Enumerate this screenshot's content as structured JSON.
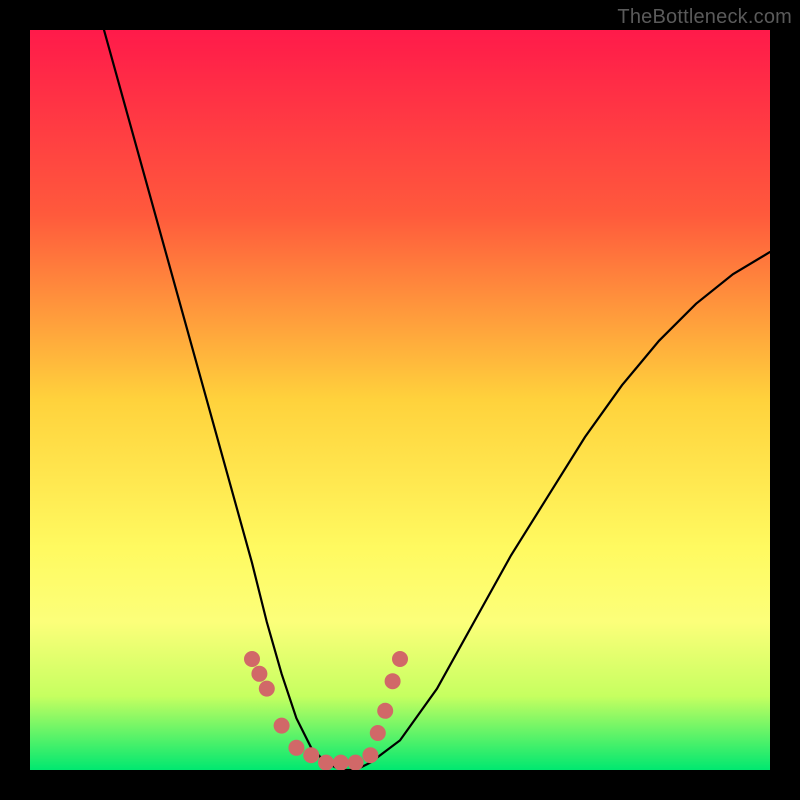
{
  "watermark": "TheBottleneck.com",
  "chart_data": {
    "type": "line",
    "title": "",
    "xlabel": "",
    "ylabel": "",
    "xlim": [
      0,
      100
    ],
    "ylim": [
      0,
      100
    ],
    "series": [
      {
        "name": "bottleneck-curve",
        "x": [
          10,
          15,
          20,
          25,
          30,
          32,
          34,
          36,
          38,
          40,
          42,
          44,
          46,
          50,
          55,
          60,
          65,
          70,
          75,
          80,
          85,
          90,
          95,
          100
        ],
        "y": [
          100,
          82,
          64,
          46,
          28,
          20,
          13,
          7,
          3,
          1,
          0,
          0,
          1,
          4,
          11,
          20,
          29,
          37,
          45,
          52,
          58,
          63,
          67,
          70
        ]
      }
    ],
    "markers": {
      "name": "highlight-dots",
      "color": "#d16868",
      "points": [
        {
          "x": 30,
          "y": 15
        },
        {
          "x": 31,
          "y": 13
        },
        {
          "x": 32,
          "y": 11
        },
        {
          "x": 34,
          "y": 6
        },
        {
          "x": 36,
          "y": 3
        },
        {
          "x": 38,
          "y": 2
        },
        {
          "x": 40,
          "y": 1
        },
        {
          "x": 42,
          "y": 1
        },
        {
          "x": 44,
          "y": 1
        },
        {
          "x": 46,
          "y": 2
        },
        {
          "x": 47,
          "y": 5
        },
        {
          "x": 48,
          "y": 8
        },
        {
          "x": 49,
          "y": 12
        },
        {
          "x": 50,
          "y": 15
        }
      ]
    }
  }
}
